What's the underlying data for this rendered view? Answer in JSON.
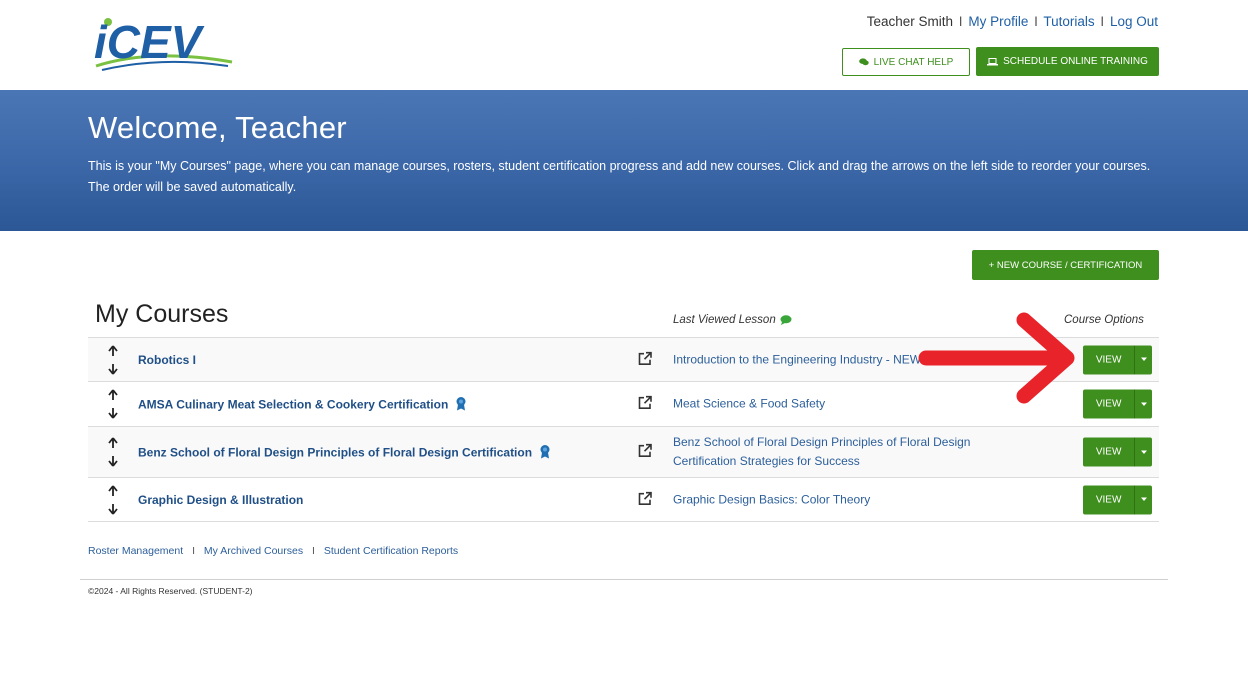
{
  "header": {
    "logo_text": "iCEV",
    "user_name": "Teacher Smith",
    "links": [
      "My Profile",
      "Tutorials",
      "Log Out"
    ],
    "live_chat_label": "LIVE CHAT HELP",
    "schedule_label": "SCHEDULE ONLINE TRAINING"
  },
  "banner": {
    "title": "Welcome, Teacher",
    "text": "This is your \"My Courses\" page, where you can manage courses, rosters, student certification progress and add new courses. Click and drag the arrows on the left side to reorder your courses. The order will be saved automatically."
  },
  "new_course_label": "+ NEW COURSE / CERTIFICATION",
  "courses": {
    "heading": "My Courses",
    "col_last_viewed": "Last Viewed Lesson",
    "col_options": "Course Options",
    "view_label": "VIEW",
    "rows": [
      {
        "name": "Robotics I",
        "cert": false,
        "lesson": "Introduction to the Engineering Industry - NEW"
      },
      {
        "name": "AMSA Culinary Meat Selection & Cookery Certification",
        "cert": true,
        "lesson": "Meat Science & Food Safety"
      },
      {
        "name": "Benz School of Floral Design Principles of Floral Design Certification",
        "cert": true,
        "lesson": "Benz School of Floral Design Principles of Floral Design Certification Strategies for Success"
      },
      {
        "name": "Graphic Design & Illustration",
        "cert": false,
        "lesson": "Graphic Design Basics: Color Theory"
      }
    ]
  },
  "footer": {
    "links": [
      "Roster Management",
      "My Archived Courses",
      "Student Certification Reports"
    ],
    "copyright": "©2024 - All Rights Reserved. (STUDENT-2)"
  },
  "colors": {
    "brand_green": "#3f8f1f",
    "banner_blue": "#3e6aab",
    "link_blue": "#1f5fa6",
    "annotation_red": "#e8232a"
  }
}
